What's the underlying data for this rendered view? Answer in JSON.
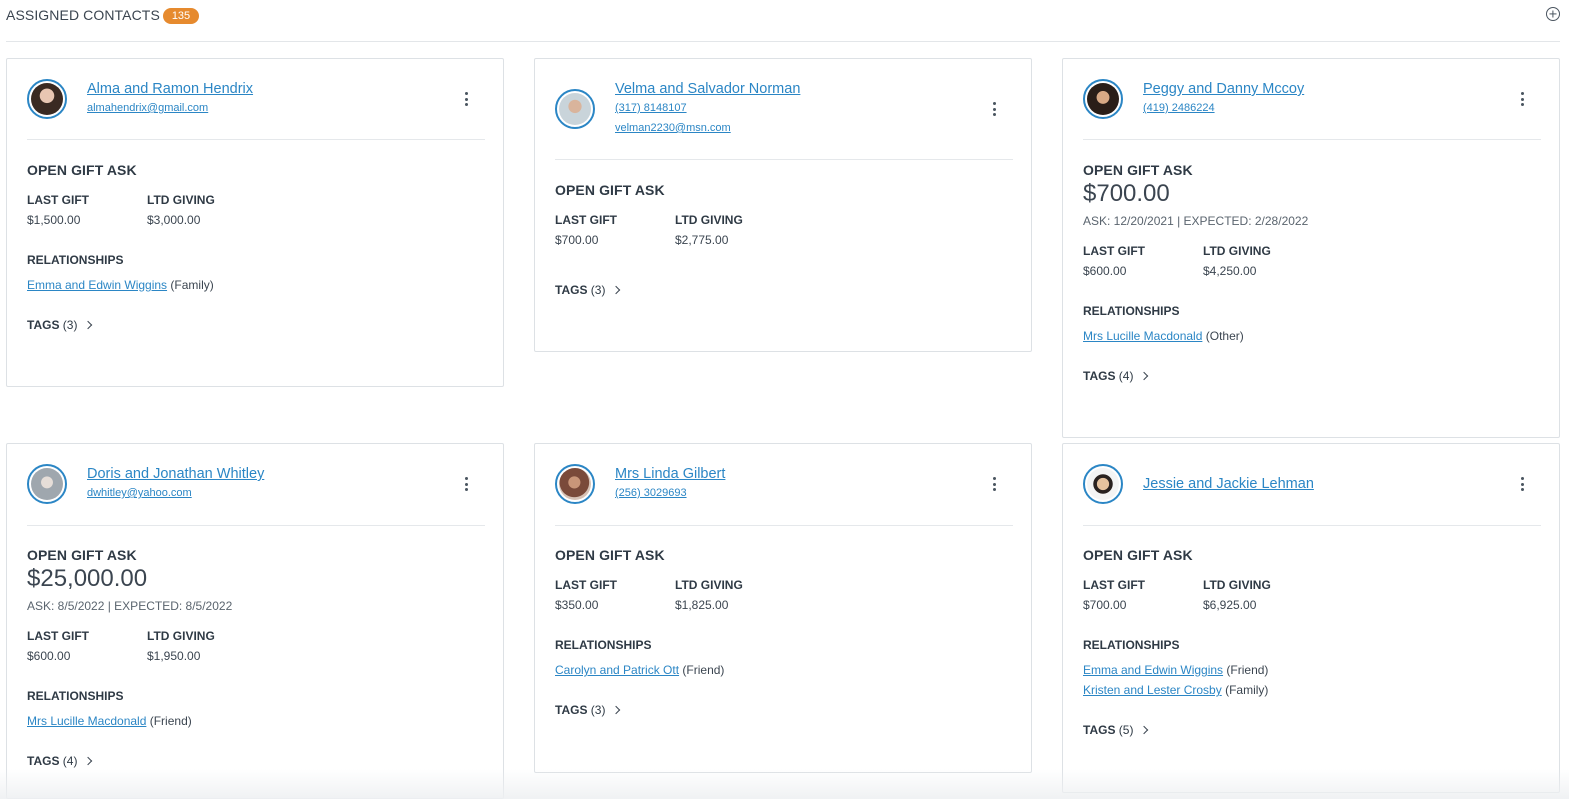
{
  "header": {
    "title": "ASSIGNED CONTACTS",
    "count": "135"
  },
  "labels": {
    "open_gift_ask": "OPEN GIFT ASK",
    "last_gift": "LAST GIFT",
    "ltd_giving": "LTD GIVING",
    "relationships": "RELATIONSHIPS"
  },
  "cards": [
    {
      "name": "Alma and Ramon Hendrix",
      "email": "almahendrix@gmail.com",
      "last_gift": "$1,500.00",
      "ltd_giving": "$3,000.00",
      "relationships": [
        {
          "name": "Emma and Edwin Wiggins",
          "type": "(Family)"
        }
      ],
      "tags": "TAGS",
      "tags_count": "(3)"
    },
    {
      "name": "Velma and Salvador Norman",
      "phone": "(317) 8148107",
      "email": "velman2230@msn.com",
      "last_gift": "$700.00",
      "ltd_giving": "$2,775.00",
      "tags": "TAGS",
      "tags_count": "(3)"
    },
    {
      "name": "Peggy and Danny Mccoy",
      "phone": "(419) 2486224",
      "ask_amount": "$700.00",
      "ask_dates": "ASK: 12/20/2021 | EXPECTED: 2/28/2022",
      "last_gift": "$600.00",
      "ltd_giving": "$4,250.00",
      "relationships": [
        {
          "name": "Mrs Lucille Macdonald",
          "type": "(Other)"
        }
      ],
      "tags": "TAGS",
      "tags_count": "(4)"
    },
    {
      "name": "Doris and Jonathan Whitley",
      "email": "dwhitley@yahoo.com",
      "ask_amount": "$25,000.00",
      "ask_dates": "ASK: 8/5/2022 | EXPECTED: 8/5/2022",
      "last_gift": "$600.00",
      "ltd_giving": "$1,950.00",
      "relationships": [
        {
          "name": "Mrs Lucille Macdonald",
          "type": "(Friend)"
        }
      ],
      "tags": "TAGS",
      "tags_count": "(4)"
    },
    {
      "name": "Mrs Linda Gilbert",
      "phone": "(256) 3029693",
      "last_gift": "$350.00",
      "ltd_giving": "$1,825.00",
      "relationships": [
        {
          "name": "Carolyn and Patrick Ott",
          "type": "(Friend)"
        }
      ],
      "tags": "TAGS",
      "tags_count": "(3)"
    },
    {
      "name": "Jessie and Jackie Lehman",
      "last_gift": "$700.00",
      "ltd_giving": "$6,925.00",
      "relationships": [
        {
          "name": "Emma and Edwin Wiggins",
          "type": "(Friend)"
        },
        {
          "name": "Kristen and Lester Crosby",
          "type": "(Family)"
        }
      ],
      "tags": "TAGS",
      "tags_count": "(5)"
    }
  ],
  "colors": {
    "accent": "#2b86c5",
    "badge": "#e68a2e",
    "text": "#2f3a45"
  },
  "icons": {
    "add": "add-circle-icon",
    "menu": "kebab-menu-icon",
    "tags": "chevron-right-icon"
  }
}
